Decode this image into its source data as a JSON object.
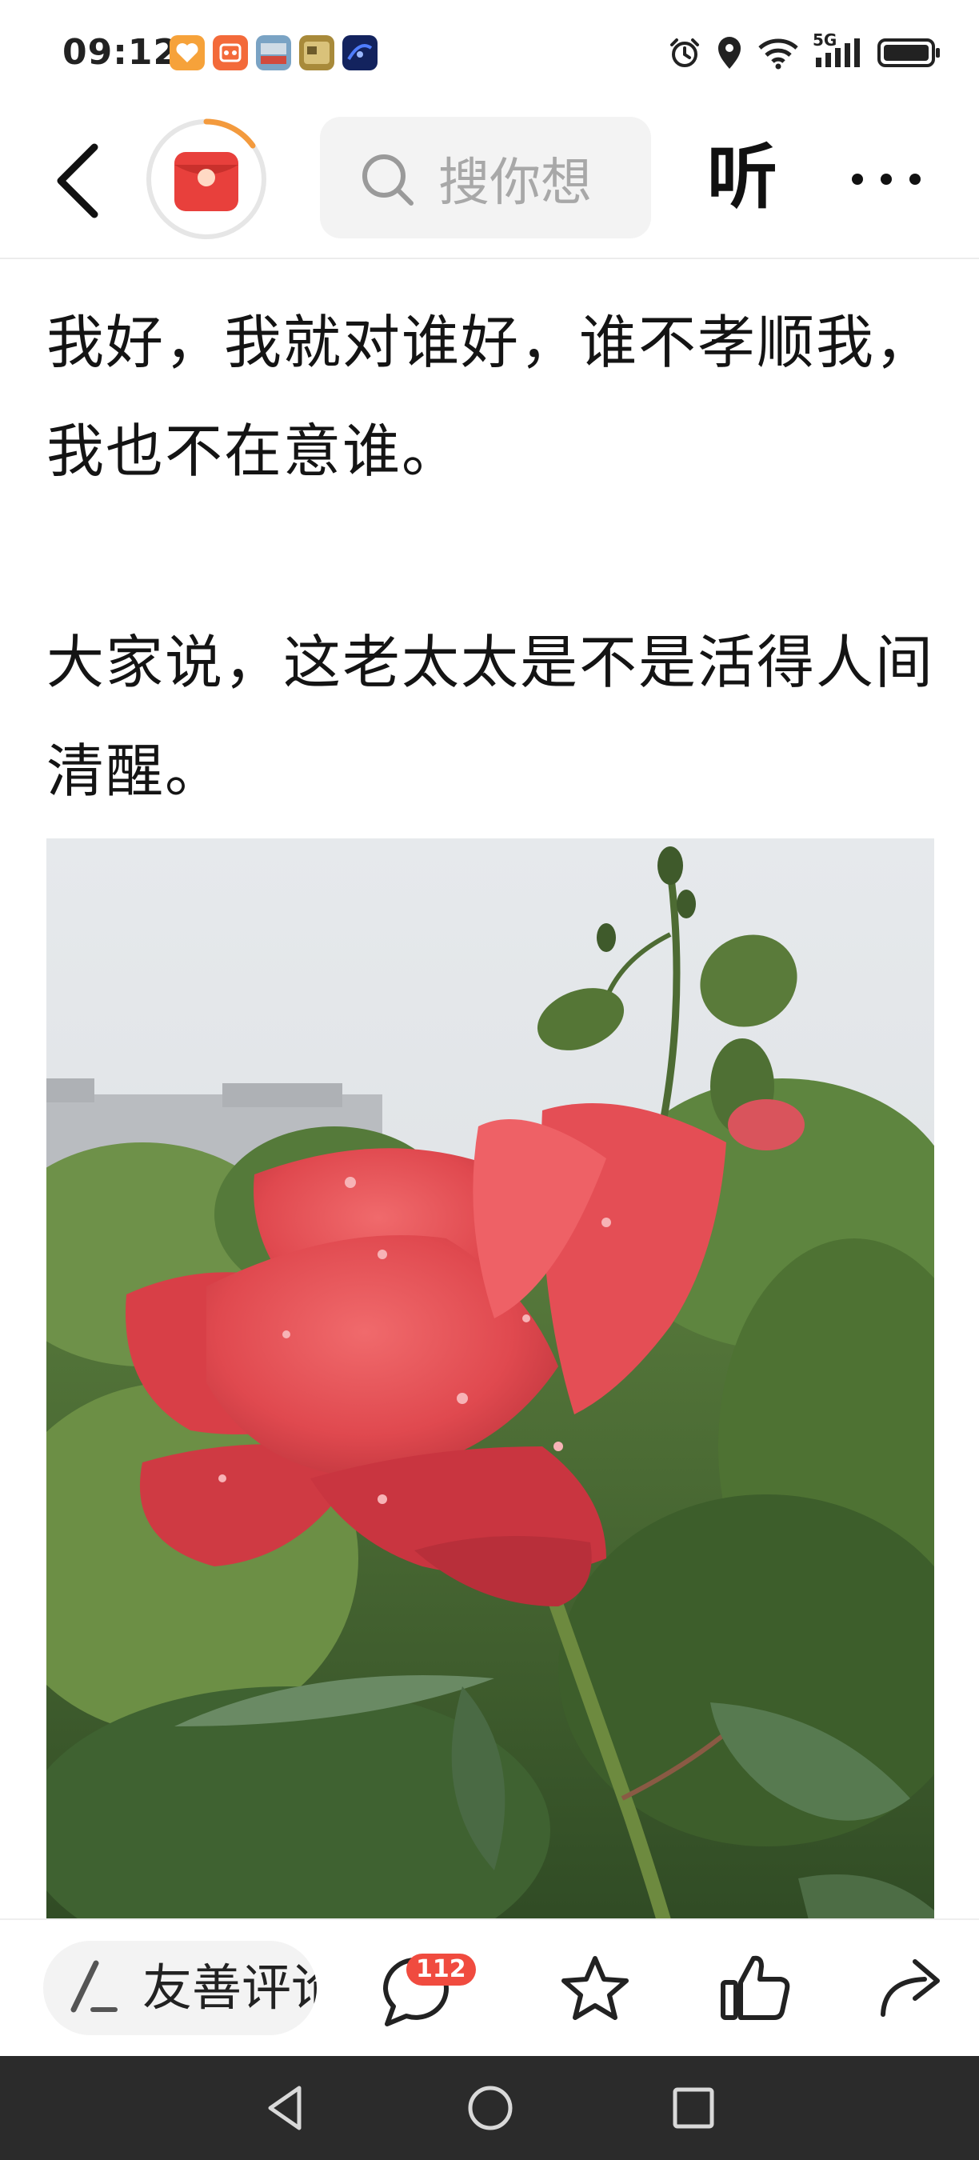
{
  "status_bar": {
    "time": "09:12",
    "network": "5G",
    "icons": [
      "alarm-icon",
      "location-icon",
      "wifi-icon",
      "signal-icon",
      "battery-icon"
    ]
  },
  "top_nav": {
    "search_placeholder": "搜你想",
    "listen_label": "听",
    "icons": [
      "back-arrow-icon",
      "red-packet-icon",
      "search-icon",
      "more-dots-icon"
    ]
  },
  "article": {
    "paragraphs": [
      "我好，我就对谁好，谁不孝顺我，我也不在意谁。",
      "大家说，这老太太是不是活得人间清醒。"
    ],
    "image": "red-rose-photo"
  },
  "action_bar": {
    "comment_label": "友善评论",
    "comment_count": "112",
    "icons": [
      "pen-icon",
      "comment-bubble-icon",
      "star-icon",
      "thumbs-up-icon",
      "share-arrow-icon"
    ]
  },
  "system_nav": {
    "icons": [
      "nav-back-icon",
      "nav-home-icon",
      "nav-recent-icon"
    ]
  },
  "colors": {
    "accent_red": "#f04b3f",
    "packet_red": "#e8403c",
    "progress_orange": "#f39a3d",
    "nav_bar_bg": "#2b2b2b"
  }
}
